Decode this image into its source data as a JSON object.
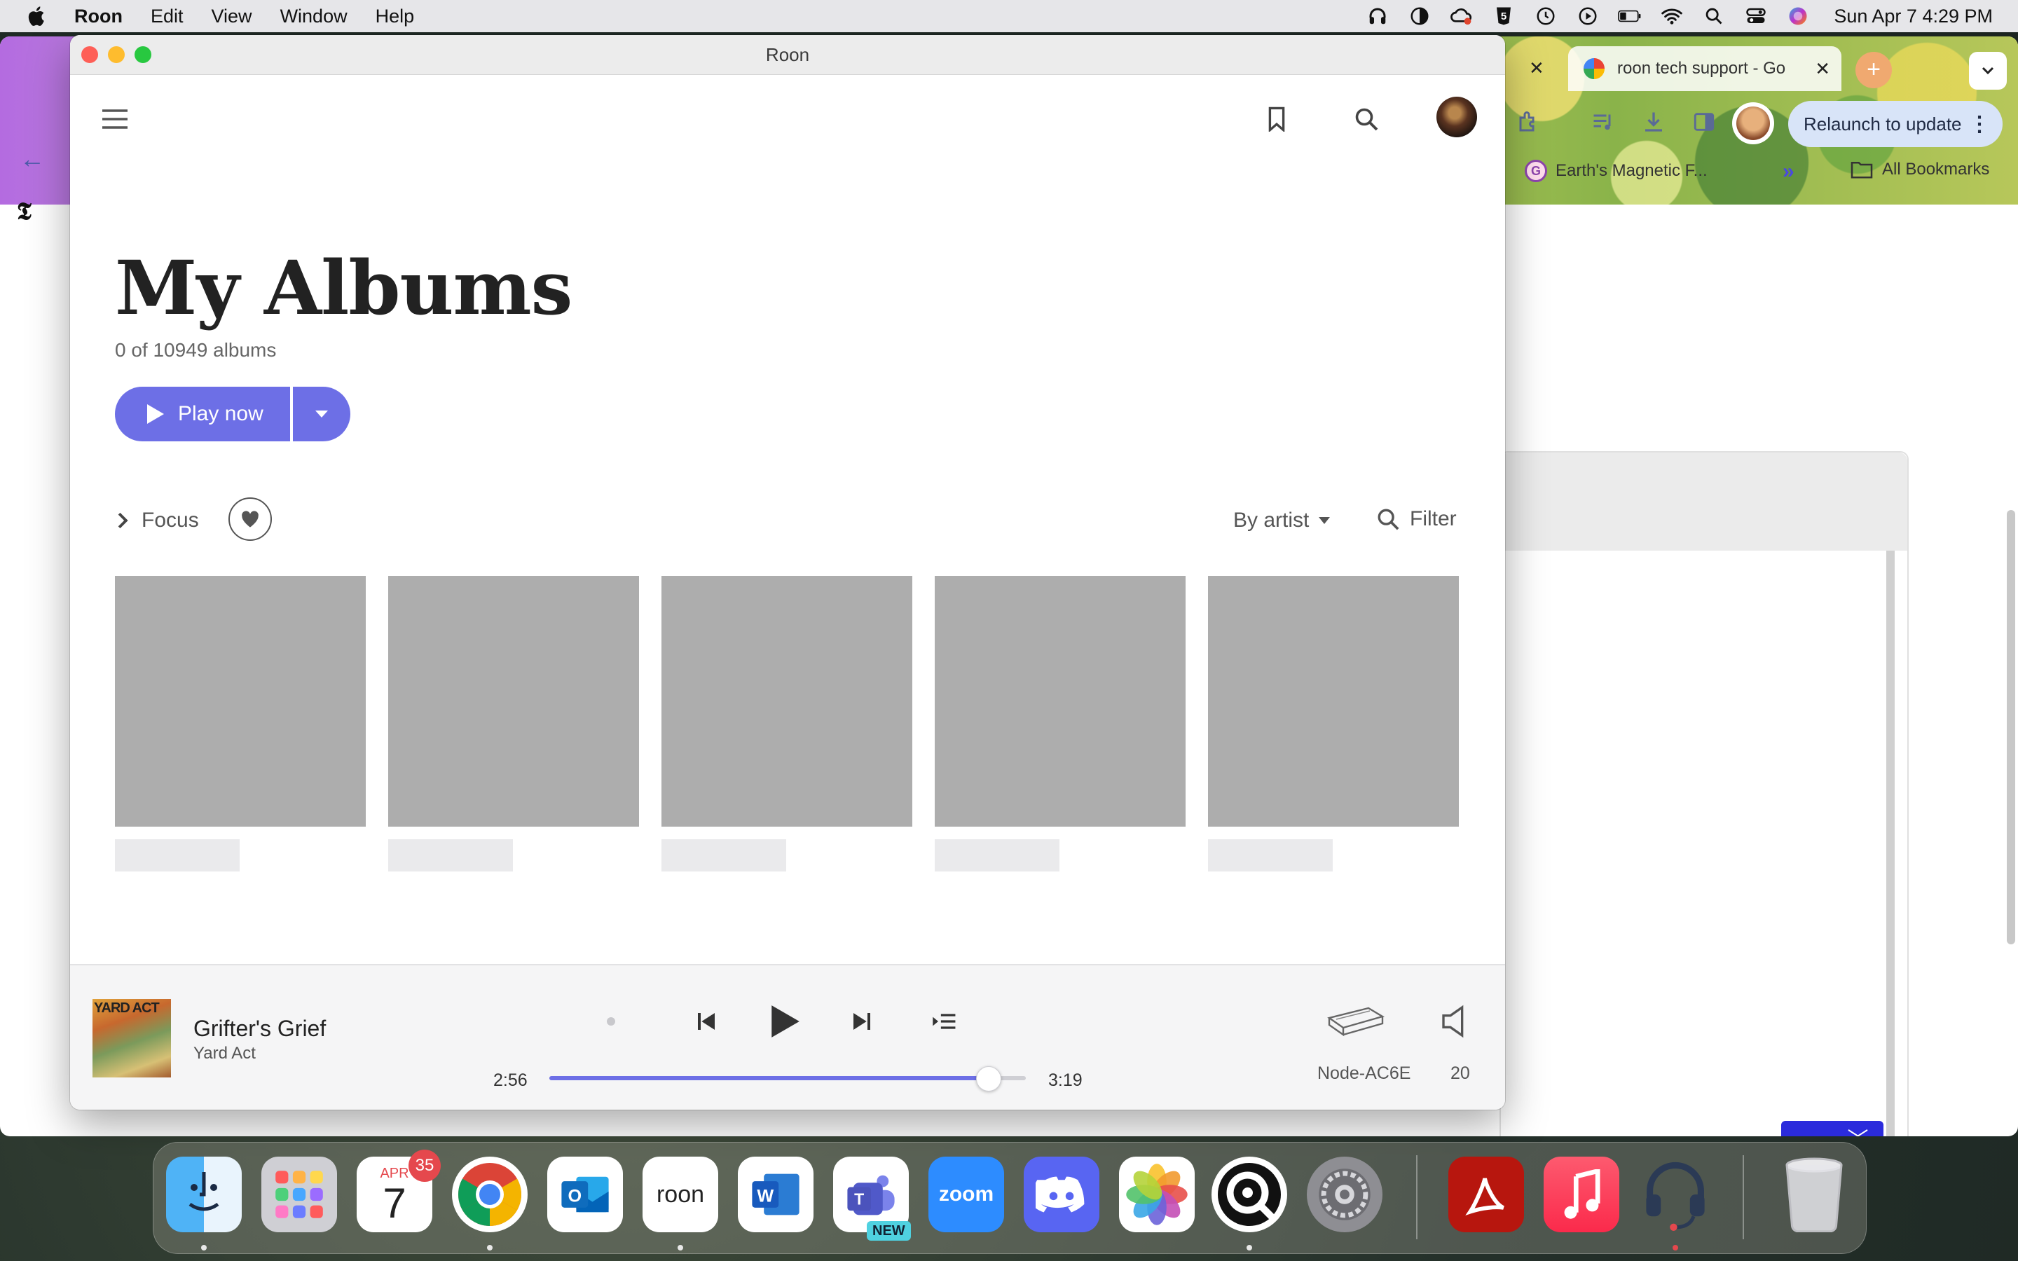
{
  "menubar": {
    "app_name": "Roon",
    "items": [
      "Edit",
      "View",
      "Window",
      "Help"
    ],
    "clock": "Sun Apr 7  4:29 PM"
  },
  "chrome": {
    "active_tab_title": "roon tech support - Go",
    "relaunch_label": "Relaunch to update",
    "bookmark_item": "Earth's Magnetic F...",
    "bookmark_g": "G",
    "all_bookmarks": "All Bookmarks",
    "nyt_glyph": "𝕿"
  },
  "window": {
    "title": "Roon"
  },
  "page": {
    "title": "My Albums",
    "count": "0 of 10949 albums",
    "play_label": "Play now",
    "focus_label": "Focus",
    "sort_label": "By artist",
    "filter_label": "Filter"
  },
  "albums": [
    {
      "placeholder": true
    },
    {
      "placeholder": true
    },
    {
      "placeholder": true
    },
    {
      "placeholder": true
    },
    {
      "placeholder": true
    }
  ],
  "now_playing": {
    "title": "Grifter's Grief",
    "artist": "Yard Act",
    "cover_text": "YARD ACT",
    "elapsed": "2:56",
    "duration": "3:19",
    "progress": 0.92,
    "zone": "Node-AC6E",
    "volume": "20"
  },
  "dock": {
    "calendar_month": "APR",
    "calendar_day": "7",
    "calendar_badge": "35",
    "roon_label": "roon",
    "zoom_label": "zoom",
    "teams_new": "NEW"
  },
  "colors": {
    "accent": "#6d6fe6",
    "placeholder": "#adadad"
  }
}
